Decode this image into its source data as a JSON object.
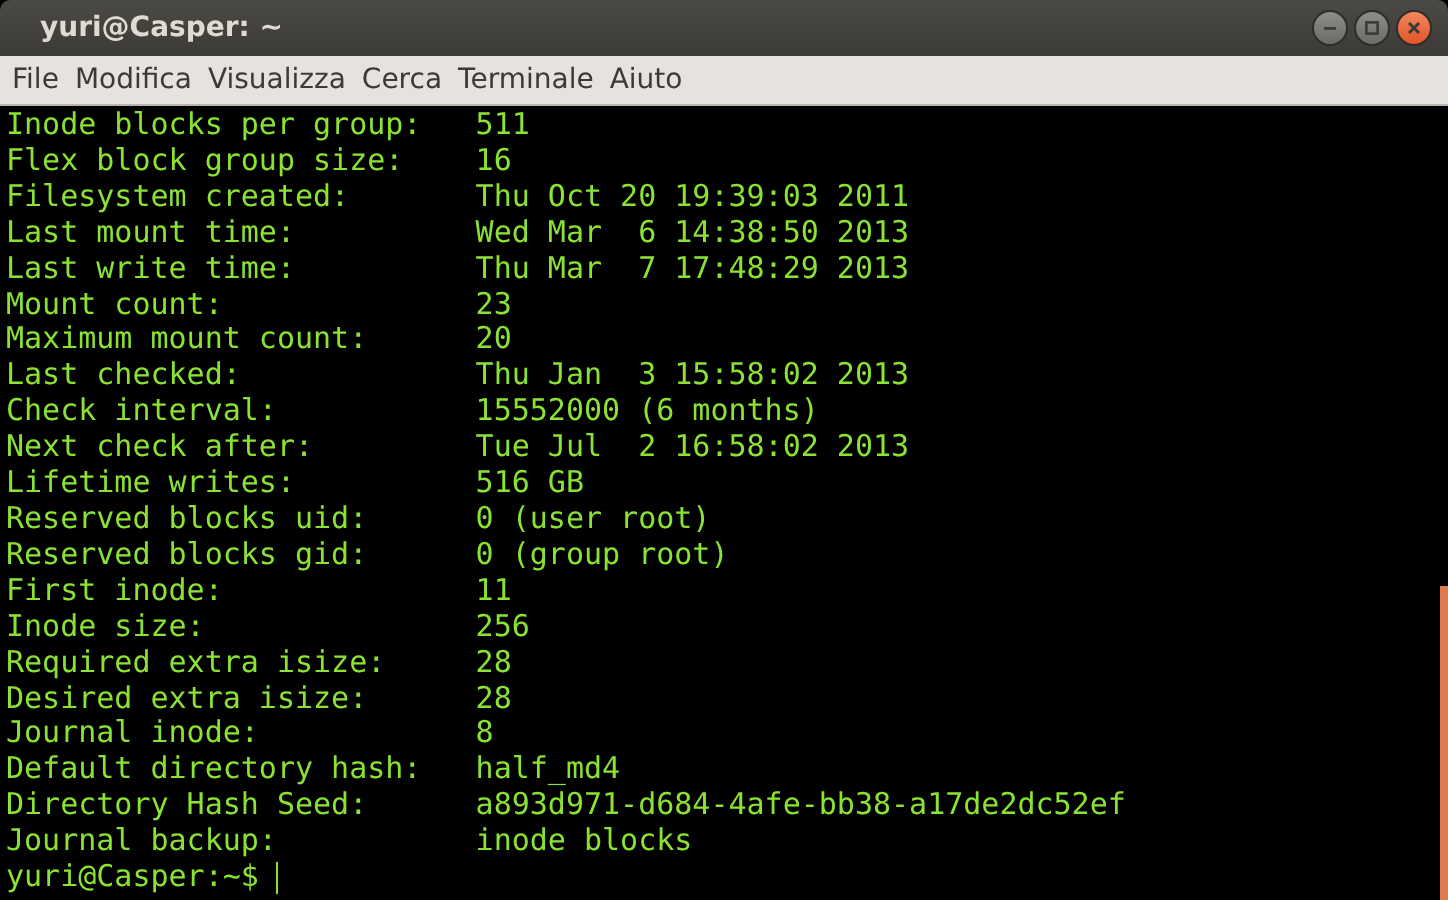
{
  "window": {
    "title": "yuri@Casper: ~"
  },
  "menu": [
    "File",
    "Modifica",
    "Visualizza",
    "Cerca",
    "Terminale",
    "Aiuto"
  ],
  "terminal": {
    "lines": [
      {
        "label": "Inode blocks per group:",
        "value": "511"
      },
      {
        "label": "Flex block group size:",
        "value": "16"
      },
      {
        "label": "Filesystem created:",
        "value": "Thu Oct 20 19:39:03 2011"
      },
      {
        "label": "Last mount time:",
        "value": "Wed Mar  6 14:38:50 2013"
      },
      {
        "label": "Last write time:",
        "value": "Thu Mar  7 17:48:29 2013"
      },
      {
        "label": "Mount count:",
        "value": "23"
      },
      {
        "label": "Maximum mount count:",
        "value": "20"
      },
      {
        "label": "Last checked:",
        "value": "Thu Jan  3 15:58:02 2013"
      },
      {
        "label": "Check interval:",
        "value": "15552000 (6 months)"
      },
      {
        "label": "Next check after:",
        "value": "Tue Jul  2 16:58:02 2013"
      },
      {
        "label": "Lifetime writes:",
        "value": "516 GB"
      },
      {
        "label": "Reserved blocks uid:",
        "value": "0 (user root)"
      },
      {
        "label": "Reserved blocks gid:",
        "value": "0 (group root)"
      },
      {
        "label": "First inode:",
        "value": "11"
      },
      {
        "label": "Inode size:",
        "value": "256"
      },
      {
        "label": "Required extra isize:",
        "value": "28"
      },
      {
        "label": "Desired extra isize:",
        "value": "28"
      },
      {
        "label": "Journal inode:",
        "value": "8"
      },
      {
        "label": "Default directory hash:",
        "value": "half_md4"
      },
      {
        "label": "Directory Hash Seed:",
        "value": "a893d971-d684-4afe-bb38-a17de2dc52ef"
      },
      {
        "label": "Journal backup:",
        "value": "inode blocks"
      }
    ],
    "prompt": "yuri@Casper:~$"
  }
}
